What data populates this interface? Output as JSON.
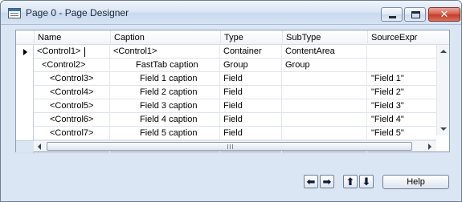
{
  "window": {
    "title": "Page 0 - Page Designer",
    "icons": {
      "app": "page-designer-icon",
      "min": "minimize-icon",
      "max": "maximize-icon",
      "close": "close-icon"
    }
  },
  "grid": {
    "columns": [
      "Name",
      "Caption",
      "Type",
      "SubType",
      "SourceExpr"
    ],
    "rows": [
      {
        "name": "<Control1>",
        "caption": "<Control1>",
        "type": "Container",
        "subtype": "ContentArea",
        "source": "",
        "current": true,
        "name_indent": 0,
        "caption_indent": 0
      },
      {
        "name": "<Control2>",
        "caption": "FastTab caption",
        "type": "Group",
        "subtype": "Group",
        "source": "",
        "name_indent": 1,
        "caption_indent": 1
      },
      {
        "name": "<Control3>",
        "caption": "Field 1 caption",
        "type": "Field",
        "subtype": "",
        "source": "\"Field 1\"",
        "name_indent": 2,
        "caption_indent": 2
      },
      {
        "name": "<Control4>",
        "caption": "Field 2 caption",
        "type": "Field",
        "subtype": "",
        "source": "\"Field 2\"",
        "name_indent": 2,
        "caption_indent": 2
      },
      {
        "name": "<Control5>",
        "caption": "Field 3 caption",
        "type": "Field",
        "subtype": "",
        "source": "\"Field 3\"",
        "name_indent": 2,
        "caption_indent": 2
      },
      {
        "name": "<Control6>",
        "caption": "Field 4 caption",
        "type": "Field",
        "subtype": "",
        "source": "\"Field 4\"",
        "name_indent": 2,
        "caption_indent": 2
      },
      {
        "name": "<Control7>",
        "caption": "Field 5 caption",
        "type": "Field",
        "subtype": "",
        "source": "\"Field 5\"",
        "name_indent": 2,
        "caption_indent": 2
      }
    ]
  },
  "buttons": {
    "move_left_icon": "arrow-left-icon",
    "move_right_icon": "arrow-right-icon",
    "move_up_icon": "arrow-up-icon",
    "move_down_icon": "arrow-down-icon",
    "help_label": "Help"
  }
}
